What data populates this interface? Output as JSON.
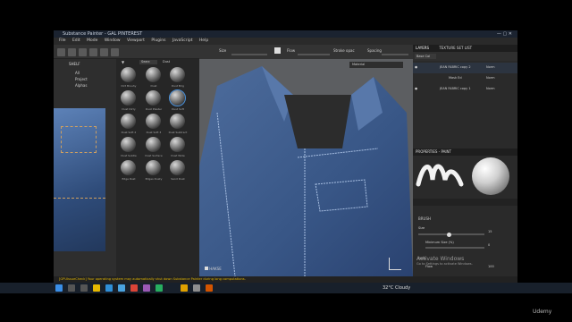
{
  "window": {
    "title": "Substance Painter - GAL PINTEREST",
    "menu": [
      "File",
      "Edit",
      "Mode",
      "Window",
      "Viewport",
      "Plugins",
      "JavaScript",
      "Help"
    ]
  },
  "toolbar": {
    "size_label": "Size",
    "flow_label": "Flow",
    "stroke_opacity_label": "Stroke opac",
    "spacing_label": "Spacing",
    "material_label": "Material"
  },
  "shelf": {
    "title": "SHELF",
    "categories": [
      "All",
      "Project",
      "Alphas"
    ],
    "search_placeholder": "Searc",
    "search_hint": "Dust",
    "brushes": [
      "Dirt Brushy",
      "Dust",
      "Dust Brig",
      "Dust Dirty",
      "Dust Plaster",
      "Dust Soft",
      "Dust Soft 2",
      "Dust Soft 3",
      "Dust Subtract",
      "Dust Subtle",
      "Dust Surface",
      "Dust Wide",
      "Edge Rust",
      "Edges Dusty",
      "Sand Dust"
    ]
  },
  "viewport": {
    "label": "HAKSE"
  },
  "layers": {
    "tab_layers": "LAYERS",
    "tab_texture_set": "TEXTURE SET LIST",
    "blend_mode": "Base Col",
    "rows": [
      {
        "name": "JEAN FABRIC copy 2",
        "mode": "Norm",
        "opacity": "100"
      },
      {
        "name": "Mask Ed",
        "mode": "Norm",
        "opacity": "100"
      },
      {
        "name": "JEAN FABRIC copy 1",
        "mode": "Norm",
        "opacity": "100"
      }
    ]
  },
  "properties": {
    "title": "PROPERTIES - PAINT",
    "section_brush": "BRUSH",
    "size_label": "Size",
    "size_value": "15",
    "min_size_label": "Minimum Size (%)",
    "min_size_value": "0",
    "flow_section": "Flow",
    "flow_label": "Flow",
    "flow_value": "100"
  },
  "activation": {
    "title": "Activate Windows",
    "subtitle": "Go to Settings to activate Windows."
  },
  "statusbar": {
    "text": "[GPUIssueCheck] Your operating system may automatically shut down Substance Painter during long computations."
  },
  "taskbar": {
    "weather": "32°C  Cloudy"
  },
  "watermark": "Udemy",
  "colors": {
    "accent": "#e6a800",
    "jacket": "#3f5d8a",
    "denim": "#4a6ea3"
  }
}
